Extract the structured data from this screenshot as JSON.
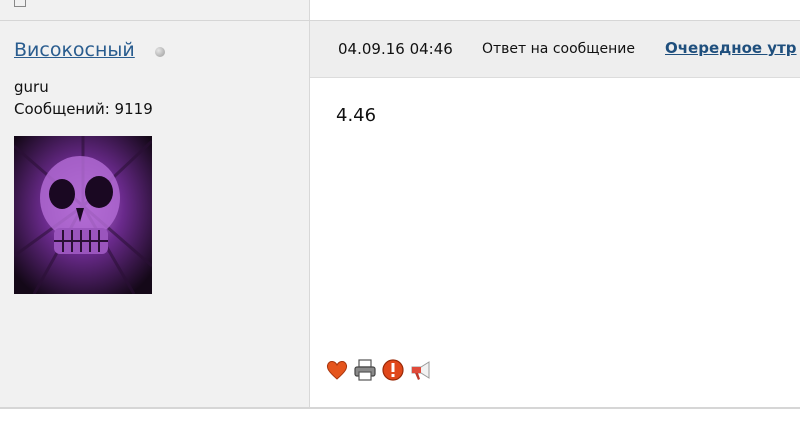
{
  "author": {
    "name": "Високосный",
    "rank": "guru",
    "posts": "Сообщений: 9119",
    "status_icon": "offline-dot"
  },
  "post": {
    "date": "04.09.16 04:46",
    "reply_label": "Ответ на сообщение",
    "reply_link": "Очередное утр",
    "text": "4.46"
  },
  "actions": {
    "icons": [
      "heart-icon",
      "print-icon",
      "report-icon",
      "megaphone-icon"
    ]
  },
  "colors": {
    "author_link": "#2a5d8f",
    "reply_link": "#1f4f7d",
    "author_bg": "#f1f1f1",
    "header_bg": "#eeeeee"
  }
}
